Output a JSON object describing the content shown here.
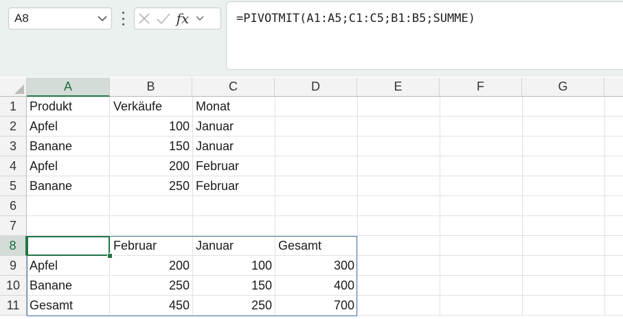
{
  "name_box": {
    "value": "A8"
  },
  "formula_bar": {
    "formula": "=PIVOTMIT(A1:A5;C1:C5;B1:B5;SUMME)",
    "fx_label": "fx"
  },
  "icons": {
    "name_box_dropdown": "chevron-down-icon",
    "more": "more-vertical-icon",
    "cancel": "close-icon",
    "enter": "check-icon",
    "function": "fx-icon",
    "fx_dropdown": "chevron-down-icon"
  },
  "colors": {
    "accent": "#217346",
    "spill_border": "#4a7fb5",
    "header_bg": "#f3f3f3"
  },
  "columns": [
    "A",
    "B",
    "C",
    "D",
    "E",
    "F",
    "G"
  ],
  "rows": [
    "1",
    "2",
    "3",
    "4",
    "5",
    "6",
    "7",
    "8",
    "9",
    "10",
    "11"
  ],
  "selected_column": "A",
  "selected_row": "8",
  "cells": {
    "A1": "Produkt",
    "B1": "Verkäufe",
    "C1": "Monat",
    "A2": "Apfel",
    "B2": "100",
    "C2": "Januar",
    "A3": "Banane",
    "B3": "150",
    "C3": "Januar",
    "A4": "Apfel",
    "B4": "200",
    "C4": "Februar",
    "A5": "Banane",
    "B5": "250",
    "C5": "Februar",
    "A8": "",
    "B8": "Februar",
    "C8": "Januar",
    "D8": "Gesamt",
    "A9": "Apfel",
    "B9": "200",
    "C9": "100",
    "D9": "300",
    "A10": "Banane",
    "B10": "250",
    "C10": "150",
    "D10": "400",
    "A11": "Gesamt",
    "B11": "450",
    "C11": "250",
    "D11": "700"
  }
}
